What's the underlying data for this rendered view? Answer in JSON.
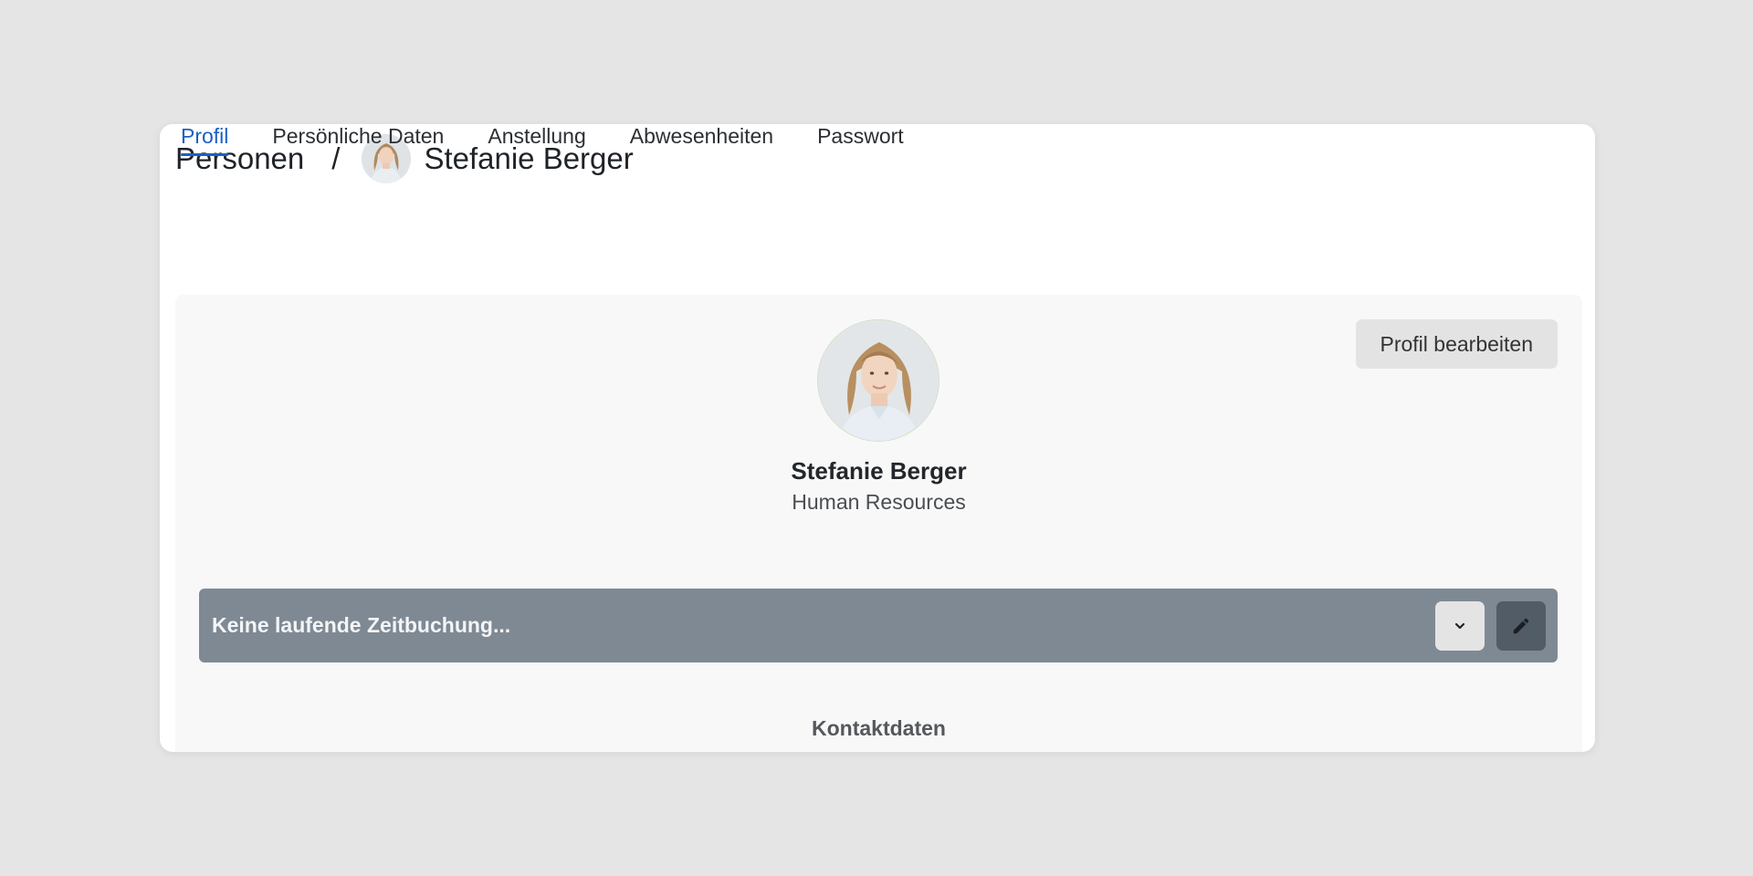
{
  "breadcrumb": {
    "root": "Personen",
    "separator": "/",
    "current": "Stefanie Berger"
  },
  "tabs": [
    {
      "label": "Profil",
      "active": true
    },
    {
      "label": "Persönliche Daten",
      "active": false
    },
    {
      "label": "Anstellung",
      "active": false
    },
    {
      "label": "Abwesenheiten",
      "active": false
    },
    {
      "label": "Passwort",
      "active": false
    }
  ],
  "profile": {
    "name": "Stefanie Berger",
    "department": "Human Resources",
    "edit_button_label": "Profil bearbeiten",
    "avatar_icon": "user-photo-avatar"
  },
  "time_tracking": {
    "status_text": "Keine laufende Zeitbuchung...",
    "dropdown_icon": "chevron-down-icon",
    "edit_icon": "pencil-icon"
  },
  "sections": {
    "contact_title": "Kontaktdaten"
  },
  "colors": {
    "accent": "#1d5fc7",
    "timer_bar": "#7f8994",
    "timer_edit_button": "#525c66"
  }
}
